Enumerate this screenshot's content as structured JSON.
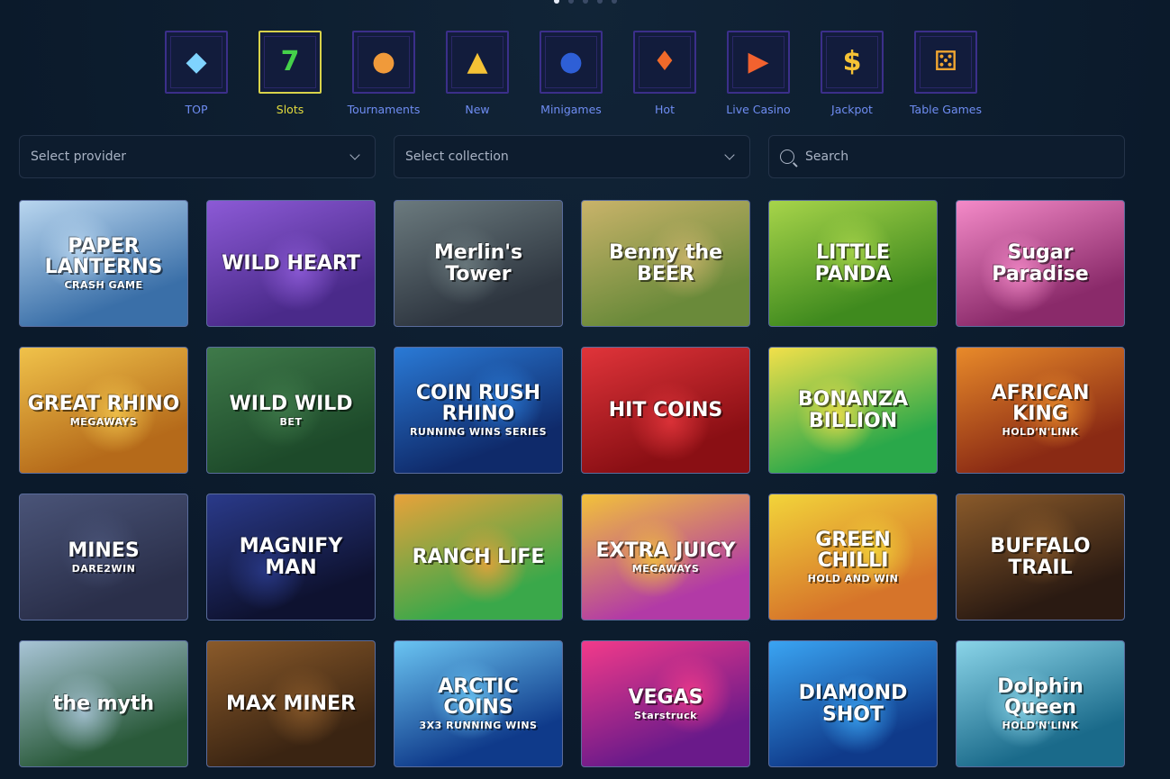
{
  "carousel": {
    "dots": 5,
    "active": 0
  },
  "categories": [
    {
      "label": "TOP",
      "icon": "diamond-icon",
      "glyph": "◆",
      "color": "#7fd3ff"
    },
    {
      "label": "Slots",
      "icon": "seven-icon",
      "glyph": "7",
      "color": "#45d14a"
    },
    {
      "label": "Tournaments",
      "icon": "medal-icon",
      "glyph": "●",
      "color": "#f09a3a"
    },
    {
      "label": "New",
      "icon": "bell-icon",
      "glyph": "▲",
      "color": "#f5c235"
    },
    {
      "label": "Minigames",
      "icon": "bomb-icon",
      "glyph": "●",
      "color": "#2e5fd6"
    },
    {
      "label": "Hot",
      "icon": "flame-icon",
      "glyph": "♦",
      "color": "#f06a2a"
    },
    {
      "label": "Live Casino",
      "icon": "play-icon",
      "glyph": "▶",
      "color": "#f2622f"
    },
    {
      "label": "Jackpot",
      "icon": "dollar-icon",
      "glyph": "$",
      "color": "#f5c235"
    },
    {
      "label": "Table Games",
      "icon": "dice-icon",
      "glyph": "⚄",
      "color": "#f0a531"
    }
  ],
  "active_category": "Slots",
  "filters": {
    "provider_placeholder": "Select provider",
    "collection_placeholder": "Select collection",
    "search_placeholder": "Search"
  },
  "games": [
    {
      "title": "PAPER LANTERNS",
      "sub": "CRASH GAME",
      "bg": "#3a6fa8",
      "bg2": "#b9d6ef"
    },
    {
      "title": "WILD HEART",
      "sub": "",
      "bg": "#4a2a8a",
      "bg2": "#8c5ad6"
    },
    {
      "title": "Merlin's Tower",
      "sub": "",
      "bg": "#2e3640",
      "bg2": "#6b7a7e"
    },
    {
      "title": "Benny the BEER",
      "sub": "",
      "bg": "#6a8a3a",
      "bg2": "#c9b36a"
    },
    {
      "title": "LITTLE PANDA",
      "sub": "",
      "bg": "#3f8a1e",
      "bg2": "#a7d44a"
    },
    {
      "title": "Sugar Paradise",
      "sub": "",
      "bg": "#8a2a6a",
      "bg2": "#f48ac8"
    },
    {
      "title": "GREAT RHINO",
      "sub": "MEGAWAYS",
      "bg": "#b56a1a",
      "bg2": "#f0c24a"
    },
    {
      "title": "WILD WILD",
      "sub": "BET",
      "bg": "#1d4a2a",
      "bg2": "#3f7a4a"
    },
    {
      "title": "COIN RUSH RHINO",
      "sub": "RUNNING WINS SERIES",
      "bg": "#0f2a6a",
      "bg2": "#2a7ad6"
    },
    {
      "title": "HIT COINS",
      "sub": "",
      "bg": "#8a0f14",
      "bg2": "#e0343a"
    },
    {
      "title": "BONANZA BILLION",
      "sub": "",
      "bg": "#2aa84a",
      "bg2": "#f2e04a"
    },
    {
      "title": "AFRICAN KING",
      "sub": "HOLD'N'LINK",
      "bg": "#8a2a14",
      "bg2": "#e88a2a"
    },
    {
      "title": "MINES",
      "sub": "DARE2WIN",
      "bg": "#2a2f4a",
      "bg2": "#4a5478"
    },
    {
      "title": "MAGNIFY MAN",
      "sub": "",
      "bg": "#0e1230",
      "bg2": "#2a3a8a"
    },
    {
      "title": "RANCH LIFE",
      "sub": "",
      "bg": "#3aa84a",
      "bg2": "#e8a23a"
    },
    {
      "title": "EXTRA JUICY",
      "sub": "MEGAWAYS",
      "bg": "#b23aa6",
      "bg2": "#f2c23a"
    },
    {
      "title": "GREEN CHILLI",
      "sub": "HOLD AND WIN",
      "bg": "#d6742a",
      "bg2": "#f2d43a"
    },
    {
      "title": "BUFFALO TRAIL",
      "sub": "",
      "bg": "#2a1a12",
      "bg2": "#8a5a2a"
    },
    {
      "title": "the myth",
      "sub": "",
      "bg": "#2a5a3a",
      "bg2": "#a8c4d6"
    },
    {
      "title": "MAX MINER",
      "sub": "",
      "bg": "#3a2412",
      "bg2": "#8a5a2a"
    },
    {
      "title": "ARCTIC COINS",
      "sub": "3X3 RUNNING WINS",
      "bg": "#0f3a8a",
      "bg2": "#6ac4f2"
    },
    {
      "title": "VEGAS",
      "sub": "Starstruck",
      "bg": "#6a1a8a",
      "bg2": "#f23a8a"
    },
    {
      "title": "DIAMOND SHOT",
      "sub": "",
      "bg": "#0f3a8a",
      "bg2": "#3aa4f2"
    },
    {
      "title": "Dolphin Queen",
      "sub": "HOLD'N'LINK",
      "bg": "#1a6a8a",
      "bg2": "#8ad4e8"
    }
  ]
}
